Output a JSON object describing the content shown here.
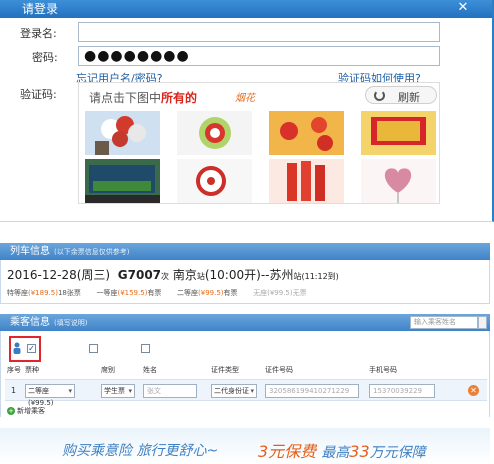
{
  "dialog": {
    "title": "请登录",
    "close_glyph": "✕",
    "username_label": "登录名:",
    "username_value": "",
    "password_label": "密码:",
    "password_value": "●●●●●●●●",
    "forgot_link": "忘记用户名/密码?",
    "captcha_help_link": "验证码如何使用?",
    "captcha_label": "验证码:",
    "captcha": {
      "instruction_prefix": "请点击下图中",
      "instruction_highlight": "所有的",
      "logo_text": "烟花",
      "refresh_label": "刷新"
    }
  },
  "train_panel": {
    "header": "列车信息",
    "header_note": "(以下余票信息仅供参考)",
    "date": "2016-12-28",
    "weekday": "(周三)",
    "train_no": "G7007",
    "train_suffix": "次",
    "from_station": "南京",
    "station_suffix": "站",
    "depart": "(10:00开)",
    "arrow": "--",
    "to_station": "苏州",
    "arrive": "(11:12到)",
    "seats": [
      {
        "name": "特等座",
        "price": "(¥189.5)",
        "status": "18张票"
      },
      {
        "name": "一等座",
        "price": "(¥159.5)",
        "status": "有票"
      },
      {
        "name": "二等座",
        "price": "(¥99.5)",
        "status": "有票"
      },
      {
        "name": "无座",
        "price": "(¥99.5)",
        "status": "无票"
      }
    ]
  },
  "passenger_panel": {
    "header": "乘客信息",
    "header_note": "(填写说明)",
    "search_placeholder": "输入乘客姓名",
    "columns": [
      "序号",
      "票种",
      "席别",
      "姓名",
      "证件类型",
      "证件号码",
      "手机号码"
    ],
    "row": {
      "index": "1",
      "seat_type": "二等座(¥99.5)",
      "ticket_type": "学生票",
      "name": "张文",
      "id_type": "二代身份证",
      "id_number": "320586199410271229",
      "phone": "15370039229"
    },
    "add_label": "新增乘客",
    "delete_glyph": "✕"
  },
  "banner": {
    "left_text": "购买乘意险  旅行更舒心~",
    "right_prefix": "3元保费",
    "right_mid": "最高",
    "right_num": "33",
    "right_suffix": "万元保障"
  },
  "colors": {
    "title_bar": "#2c7fc4",
    "link": "#1e5fa6",
    "highlight_red": "#d9251c",
    "price_orange": "#e86d1b"
  }
}
